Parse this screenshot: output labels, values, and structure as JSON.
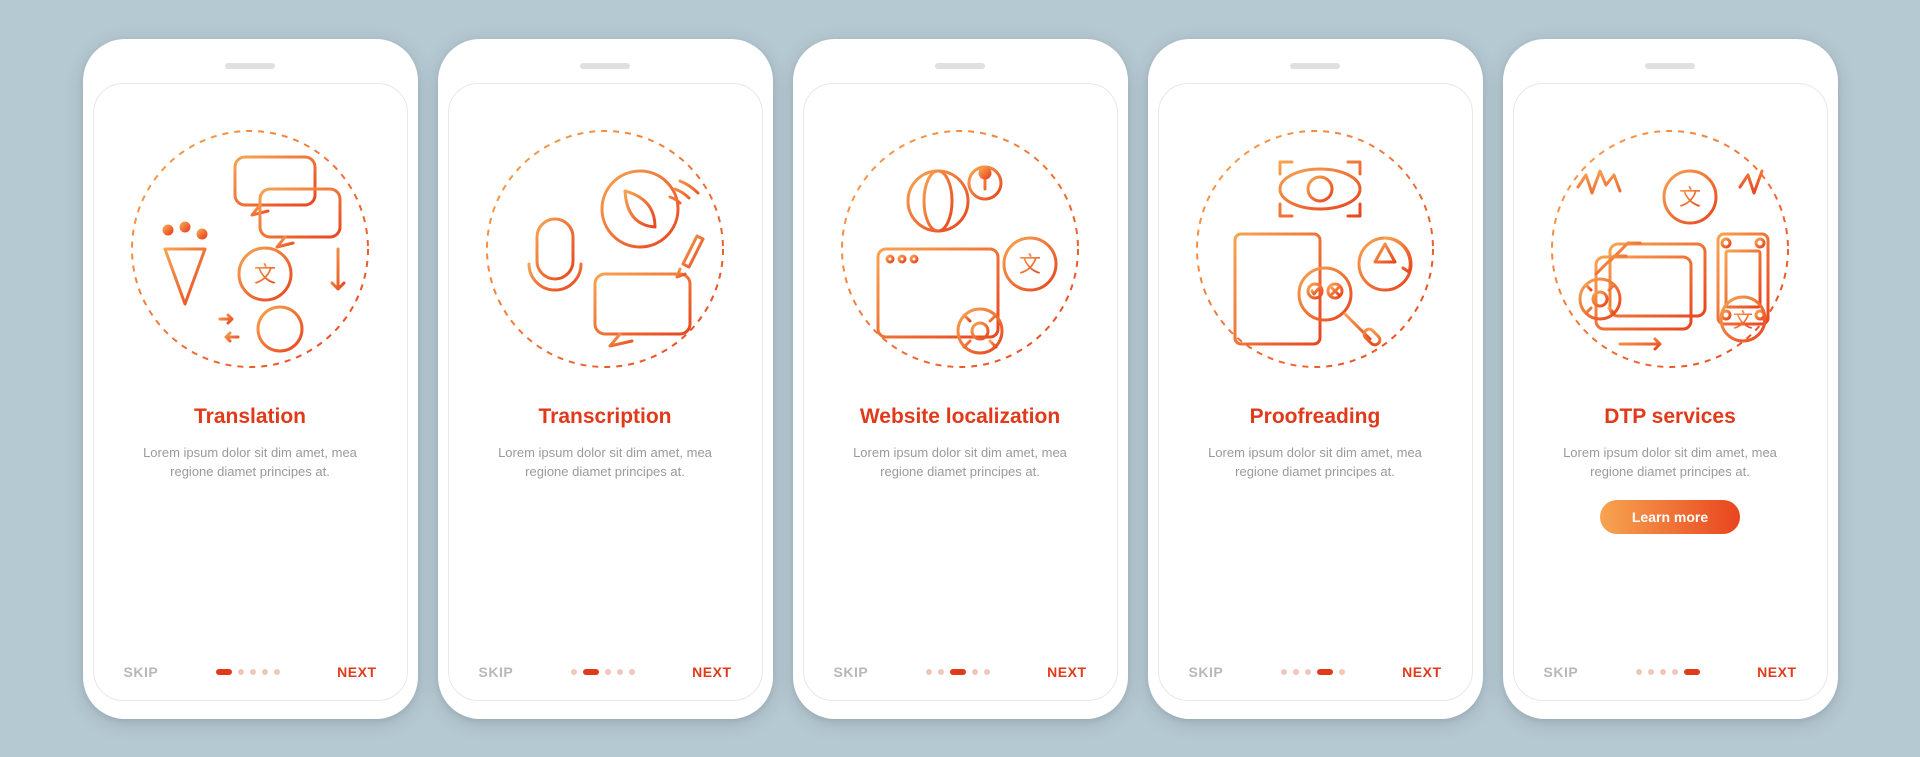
{
  "common": {
    "skip_label": "SKIP",
    "next_label": "NEXT",
    "description": "Lorem ipsum dolor sit dim amet, mea regione diamet principes at.",
    "learn_more_label": "Learn more",
    "total_pages": 5,
    "colors": {
      "accent": "#e03a1a",
      "gradient_start": "#f7a451",
      "gradient_end": "#e8451e",
      "muted": "#9a9a9a"
    }
  },
  "screens": [
    {
      "title": "Translation",
      "icon": "translation-icon",
      "active_dot": 0,
      "cta": false
    },
    {
      "title": "Transcription",
      "icon": "transcription-icon",
      "active_dot": 1,
      "cta": false
    },
    {
      "title": "Website localization",
      "icon": "website-localization-icon",
      "active_dot": 2,
      "cta": false
    },
    {
      "title": "Proofreading",
      "icon": "proofreading-icon",
      "active_dot": 3,
      "cta": false
    },
    {
      "title": "DTP services",
      "icon": "dtp-services-icon",
      "active_dot": 4,
      "cta": true
    }
  ]
}
